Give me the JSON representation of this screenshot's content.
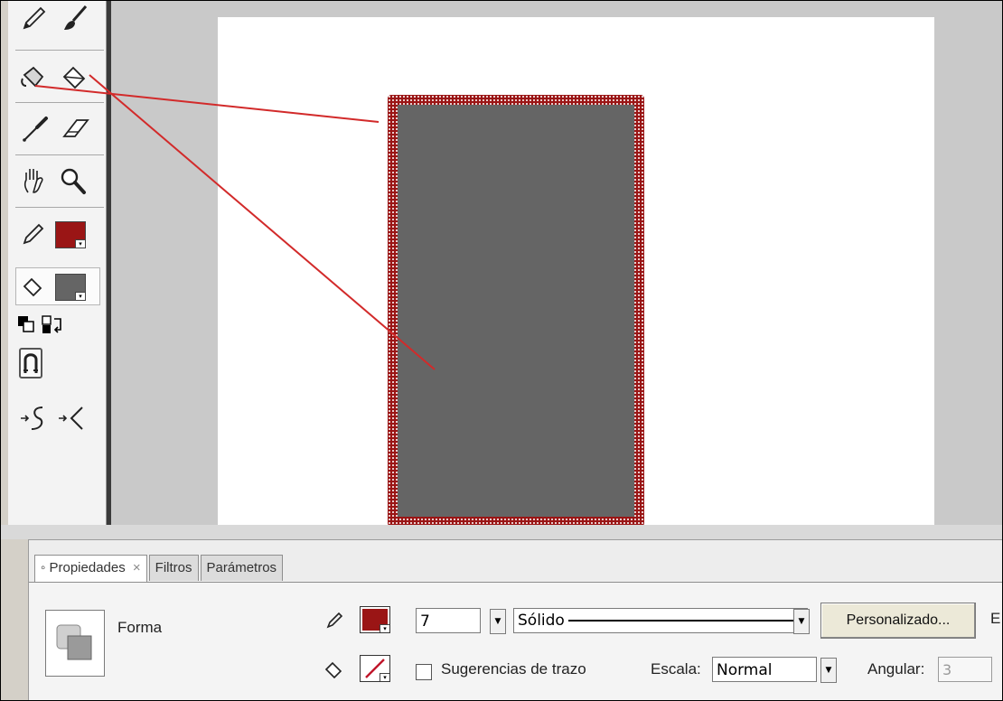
{
  "colors": {
    "stroke": "#9a1515",
    "fill": "#656565",
    "annotation": "#d22a2a"
  },
  "toolbox": {
    "tools": [
      {
        "name": "pencil-tool",
        "icon": "pencil-icon"
      },
      {
        "name": "brush-tool",
        "icon": "brush-icon"
      },
      {
        "name": "ink-bottle-tool",
        "icon": "ink-bottle-icon"
      },
      {
        "name": "paint-bucket-tool",
        "icon": "paint-bucket-icon"
      },
      {
        "name": "eyedropper-tool",
        "icon": "eyedropper-icon"
      },
      {
        "name": "eraser-tool",
        "icon": "eraser-icon"
      },
      {
        "name": "hand-tool",
        "icon": "hand-icon"
      },
      {
        "name": "zoom-tool",
        "icon": "magnifier-icon"
      },
      {
        "name": "stroke-color",
        "icon": "pencil-icon"
      },
      {
        "name": "fill-color",
        "icon": "paint-bucket-icon"
      },
      {
        "name": "default-colors",
        "icon": "black-white-icon"
      },
      {
        "name": "swap-colors",
        "icon": "swap-icon"
      },
      {
        "name": "snap-to-objects",
        "icon": "magnet-icon"
      },
      {
        "name": "smooth",
        "icon": "smooth-icon"
      },
      {
        "name": "straighten",
        "icon": "straighten-icon"
      }
    ]
  },
  "panel": {
    "tabs": [
      {
        "label": "Propiedades",
        "active": true,
        "close": "×",
        "marker": "◦"
      },
      {
        "label": "Filtros",
        "active": false
      },
      {
        "label": "Parámetros",
        "active": false
      }
    ],
    "shape_label": "Forma",
    "stroke_height": "7",
    "stroke_style": "Sólido",
    "custom_button": "Personalizado...",
    "edge_text": "E",
    "hinting_label": "Sugerencias de trazo",
    "scale_label": "Escala:",
    "scale_value": "Normal",
    "angle_label": "Angular:",
    "angle_value": "3"
  }
}
